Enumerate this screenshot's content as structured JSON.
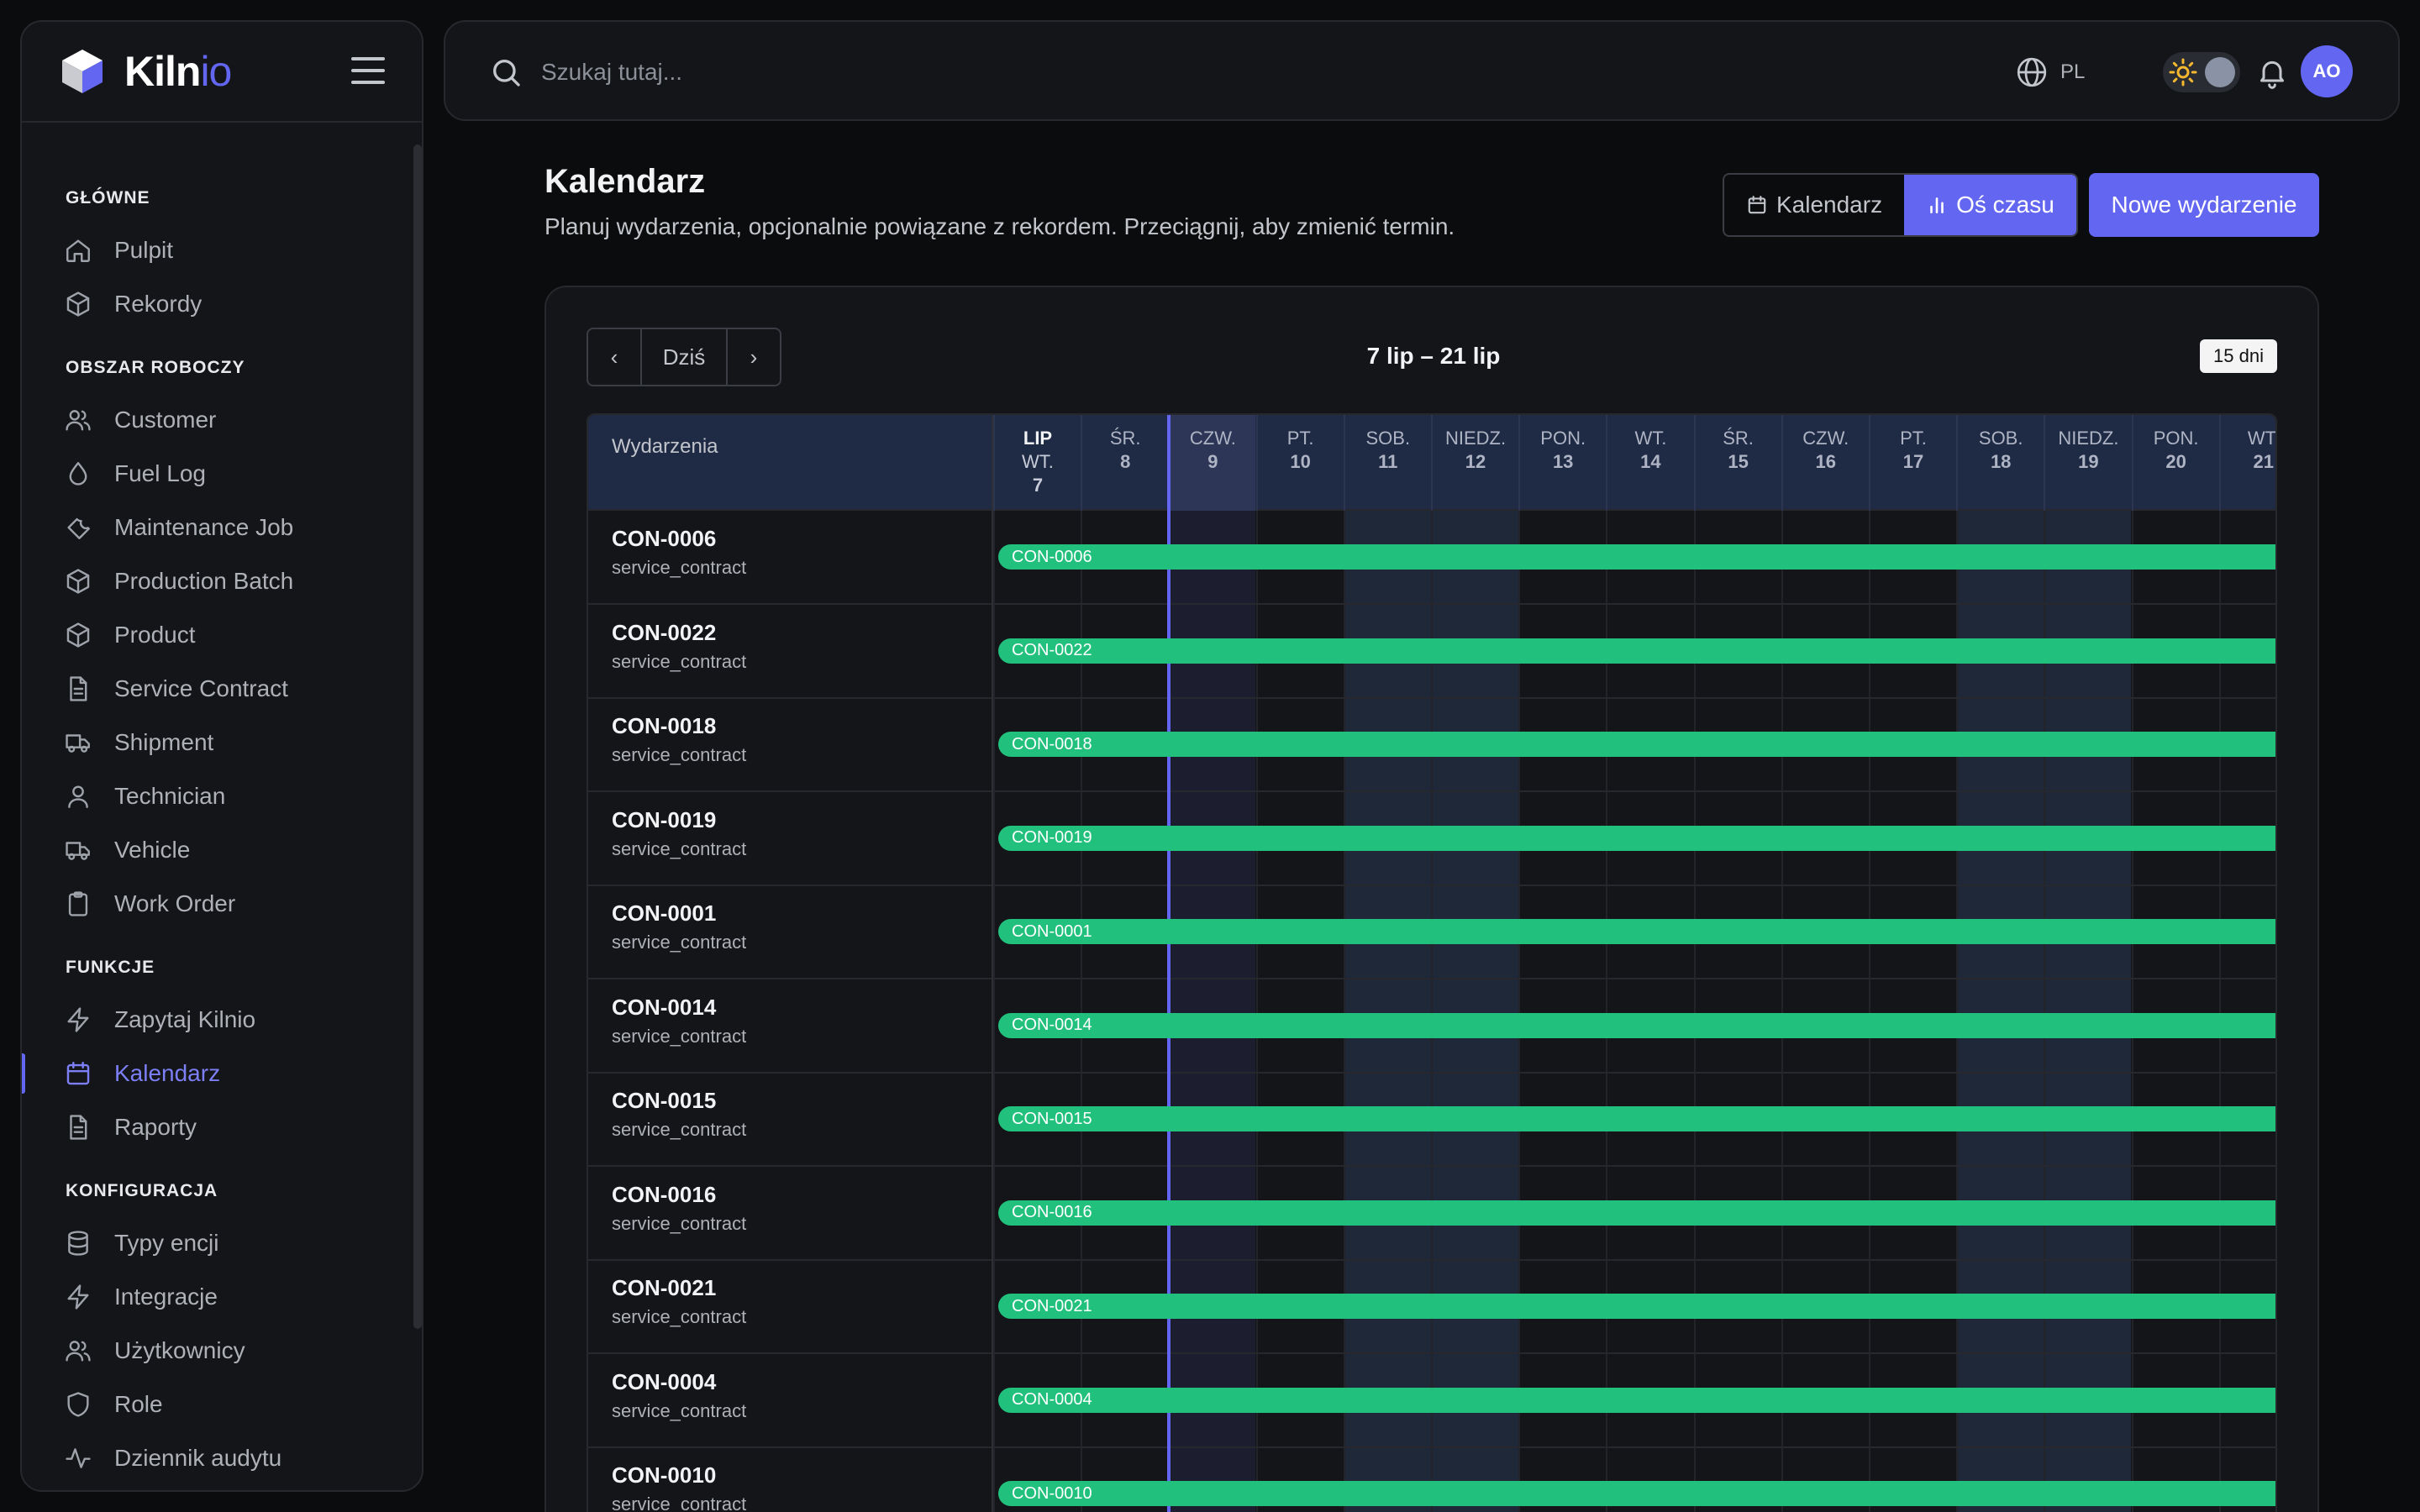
{
  "brand": {
    "name_main": "Kiln",
    "name_accent": "io"
  },
  "sidebar": {
    "sections": [
      {
        "title": "GŁÓWNE",
        "items": [
          {
            "label": "Pulpit",
            "icon": "home-icon"
          },
          {
            "label": "Rekordy",
            "icon": "box-icon"
          }
        ]
      },
      {
        "title": "OBSZAR ROBOCZY",
        "items": [
          {
            "label": "Customer",
            "icon": "users-icon"
          },
          {
            "label": "Fuel Log",
            "icon": "droplet-icon"
          },
          {
            "label": "Maintenance Job",
            "icon": "wrench-icon"
          },
          {
            "label": "Production Batch",
            "icon": "box-icon"
          },
          {
            "label": "Product",
            "icon": "box-icon"
          },
          {
            "label": "Service Contract",
            "icon": "file-text-icon"
          },
          {
            "label": "Shipment",
            "icon": "truck-icon"
          },
          {
            "label": "Technician",
            "icon": "user-icon"
          },
          {
            "label": "Vehicle",
            "icon": "truck-icon"
          },
          {
            "label": "Work Order",
            "icon": "clipboard-icon"
          }
        ]
      },
      {
        "title": "FUNKCJE",
        "items": [
          {
            "label": "Zapytaj Kilnio",
            "icon": "zap-icon"
          },
          {
            "label": "Kalendarz",
            "icon": "calendar-icon",
            "active": true
          },
          {
            "label": "Raporty",
            "icon": "file-text-icon"
          }
        ]
      },
      {
        "title": "KONFIGURACJA",
        "items": [
          {
            "label": "Typy encji",
            "icon": "database-icon"
          },
          {
            "label": "Integracje",
            "icon": "zap-icon"
          },
          {
            "label": "Użytkownicy",
            "icon": "users-icon"
          },
          {
            "label": "Role",
            "icon": "shield-icon"
          },
          {
            "label": "Dziennik audytu",
            "icon": "activity-icon"
          }
        ]
      }
    ]
  },
  "topbar": {
    "search_placeholder": "Szukaj tutaj...",
    "language": "PL",
    "avatar_initials": "AO"
  },
  "page": {
    "title": "Kalendarz",
    "subtitle": "Planuj wydarzenia, opcjonalnie powiązane z rekordem. Przeciągnij, aby zmienić termin.",
    "view_calendar_label": "Kalendarz",
    "view_timeline_label": "Oś czasu",
    "new_event_label": "Nowe wydarzenie"
  },
  "timeline": {
    "prev_label": "‹",
    "today_label": "Dziś",
    "next_label": "›",
    "range_label": "7 lip – 21 lip",
    "days_badge": "15 dni",
    "events_column_label": "Wydarzenia",
    "month_label": "LIP",
    "days": [
      {
        "dow": "WT.",
        "num": "7"
      },
      {
        "dow": "ŚR.",
        "num": "8"
      },
      {
        "dow": "CZW.",
        "num": "9",
        "today": true
      },
      {
        "dow": "PT.",
        "num": "10"
      },
      {
        "dow": "SOB.",
        "num": "11",
        "weekend": true
      },
      {
        "dow": "NIEDZ.",
        "num": "12",
        "weekend": true
      },
      {
        "dow": "PON.",
        "num": "13"
      },
      {
        "dow": "WT.",
        "num": "14"
      },
      {
        "dow": "ŚR.",
        "num": "15"
      },
      {
        "dow": "CZW.",
        "num": "16"
      },
      {
        "dow": "PT.",
        "num": "17"
      },
      {
        "dow": "SOB.",
        "num": "18",
        "weekend": true
      },
      {
        "dow": "NIEDZ.",
        "num": "19",
        "weekend": true
      },
      {
        "dow": "PON.",
        "num": "20"
      },
      {
        "dow": "WT.",
        "num": "21"
      }
    ],
    "events": [
      {
        "title": "CON-0006",
        "type": "service_contract",
        "bar_label": "CON-0006"
      },
      {
        "title": "CON-0022",
        "type": "service_contract",
        "bar_label": "CON-0022"
      },
      {
        "title": "CON-0018",
        "type": "service_contract",
        "bar_label": "CON-0018"
      },
      {
        "title": "CON-0019",
        "type": "service_contract",
        "bar_label": "CON-0019"
      },
      {
        "title": "CON-0001",
        "type": "service_contract",
        "bar_label": "CON-0001"
      },
      {
        "title": "CON-0014",
        "type": "service_contract",
        "bar_label": "CON-0014"
      },
      {
        "title": "CON-0015",
        "type": "service_contract",
        "bar_label": "CON-0015"
      },
      {
        "title": "CON-0016",
        "type": "service_contract",
        "bar_label": "CON-0016"
      },
      {
        "title": "CON-0021",
        "type": "service_contract",
        "bar_label": "CON-0021"
      },
      {
        "title": "CON-0004",
        "type": "service_contract",
        "bar_label": "CON-0004"
      },
      {
        "title": "CON-0010",
        "type": "service_contract",
        "bar_label": "CON-0010"
      }
    ]
  },
  "colors": {
    "accent": "#6366f1",
    "event_bar": "#22c07d",
    "weekend_shade": "#1f2838",
    "today_shade": "#1c1d2f"
  }
}
